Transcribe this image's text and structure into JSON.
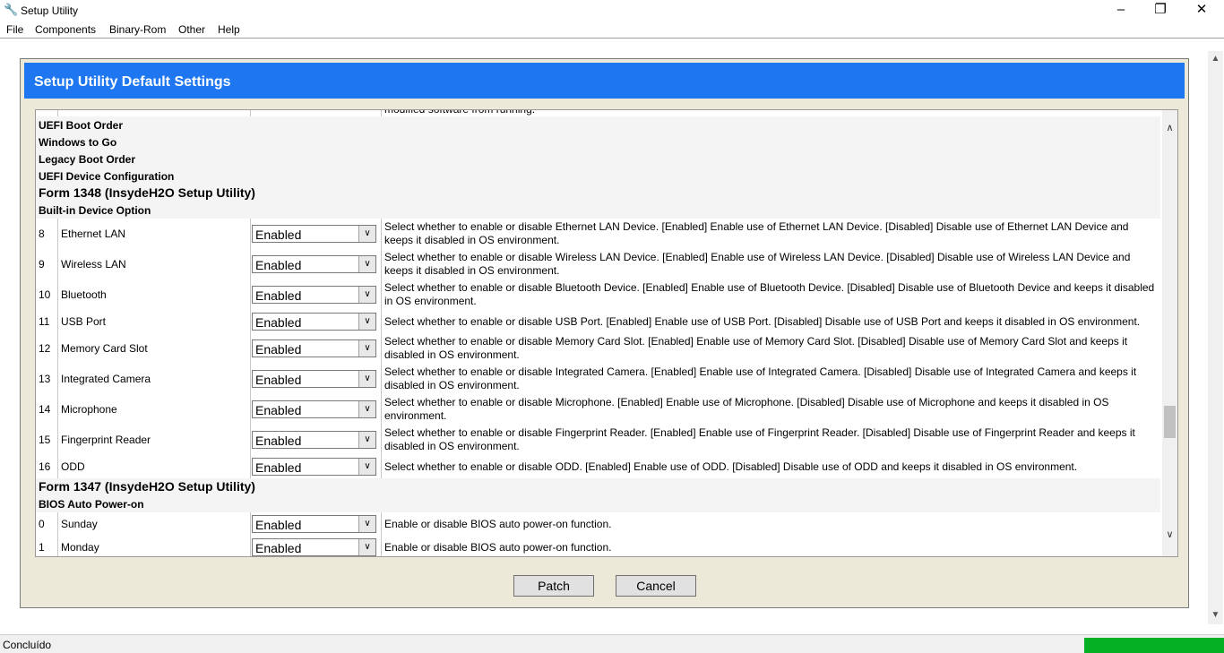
{
  "window": {
    "title": "Setup Utility",
    "icon": "wrench-icon"
  },
  "menu": [
    "File",
    "Components",
    "Binary-Rom",
    "Other",
    "Help"
  ],
  "header": {
    "title": "Setup Utility Default Settings"
  },
  "partial_text": "modified software from running.",
  "rows": [
    {
      "type": "section",
      "label": "UEFI Boot Order"
    },
    {
      "type": "section",
      "label": "Windows to Go"
    },
    {
      "type": "section",
      "label": "Legacy Boot Order"
    },
    {
      "type": "section",
      "label": "UEFI Device Configuration"
    },
    {
      "type": "form",
      "label": "Form 1348 (InsydeH2O Setup Utility)"
    },
    {
      "type": "section",
      "label": "Built-in Device Option"
    },
    {
      "type": "item",
      "index": "8",
      "name": "Ethernet LAN",
      "value": "Enabled",
      "desc": "Select whether to enable or disable Ethernet LAN Device. [Enabled] Enable use of Ethernet LAN Device. [Disabled] Disable use of Ethernet LAN Device and keeps it disabled in OS environment."
    },
    {
      "type": "item",
      "index": "9",
      "name": "Wireless LAN",
      "value": "Enabled",
      "desc": "Select whether to enable or disable Wireless LAN Device. [Enabled] Enable use of Wireless LAN Device. [Disabled] Disable use of Wireless LAN Device and keeps it disabled in OS environment."
    },
    {
      "type": "item",
      "index": "10",
      "name": "Bluetooth",
      "value": "Enabled",
      "desc": "Select whether to enable or disable Bluetooth Device. [Enabled] Enable use of Bluetooth Device. [Disabled] Disable use of Bluetooth Device and keeps it disabled in OS environment."
    },
    {
      "type": "item",
      "index": "11",
      "name": "USB Port",
      "value": "Enabled",
      "desc": "Select whether to enable or disable USB Port. [Enabled] Enable use of USB Port. [Disabled] Disable use of USB Port and keeps it disabled in OS environment."
    },
    {
      "type": "item",
      "index": "12",
      "name": "Memory Card Slot",
      "value": "Enabled",
      "desc": "Select whether to enable or disable Memory Card Slot. [Enabled] Enable use of Memory Card Slot. [Disabled] Disable use of Memory Card Slot and keeps it disabled in OS environment."
    },
    {
      "type": "item",
      "index": "13",
      "name": "Integrated Camera",
      "value": "Enabled",
      "desc": "Select whether to enable or disable Integrated Camera. [Enabled] Enable use of Integrated Camera. [Disabled] Disable use of Integrated Camera and keeps it disabled in OS environment."
    },
    {
      "type": "item",
      "index": "14",
      "name": "Microphone",
      "value": "Enabled",
      "desc": "Select whether to enable or disable Microphone. [Enabled] Enable use of Microphone. [Disabled] Disable use of Microphone and keeps it disabled in OS environment."
    },
    {
      "type": "item",
      "index": "15",
      "name": "Fingerprint Reader",
      "value": "Enabled",
      "desc": "Select whether to enable or disable Fingerprint Reader. [Enabled] Enable use of Fingerprint Reader. [Disabled] Disable use of Fingerprint Reader and keeps it disabled in OS environment."
    },
    {
      "type": "item",
      "index": "16",
      "name": "ODD",
      "value": "Enabled",
      "desc": "Select whether to enable or disable ODD. [Enabled] Enable use of ODD. [Disabled] Disable use of ODD and keeps it disabled in OS environment."
    },
    {
      "type": "form",
      "label": "Form 1347 (InsydeH2O Setup Utility)"
    },
    {
      "type": "section",
      "label": "BIOS Auto Power-on"
    },
    {
      "type": "item",
      "index": "0",
      "name": "Sunday",
      "value": "Enabled",
      "desc": "Enable or disable BIOS auto power-on function."
    },
    {
      "type": "item",
      "index": "1",
      "name": "Monday",
      "value": "Enabled",
      "desc": "Enable or disable BIOS auto power-on function."
    }
  ],
  "buttons": {
    "patch": "Patch",
    "cancel": "Cancel"
  },
  "status": {
    "text": "Concluído",
    "progress": 1.0
  },
  "colors": {
    "header": "#1e77f0",
    "progress": "#06b025",
    "panel": "#ece9d8"
  }
}
